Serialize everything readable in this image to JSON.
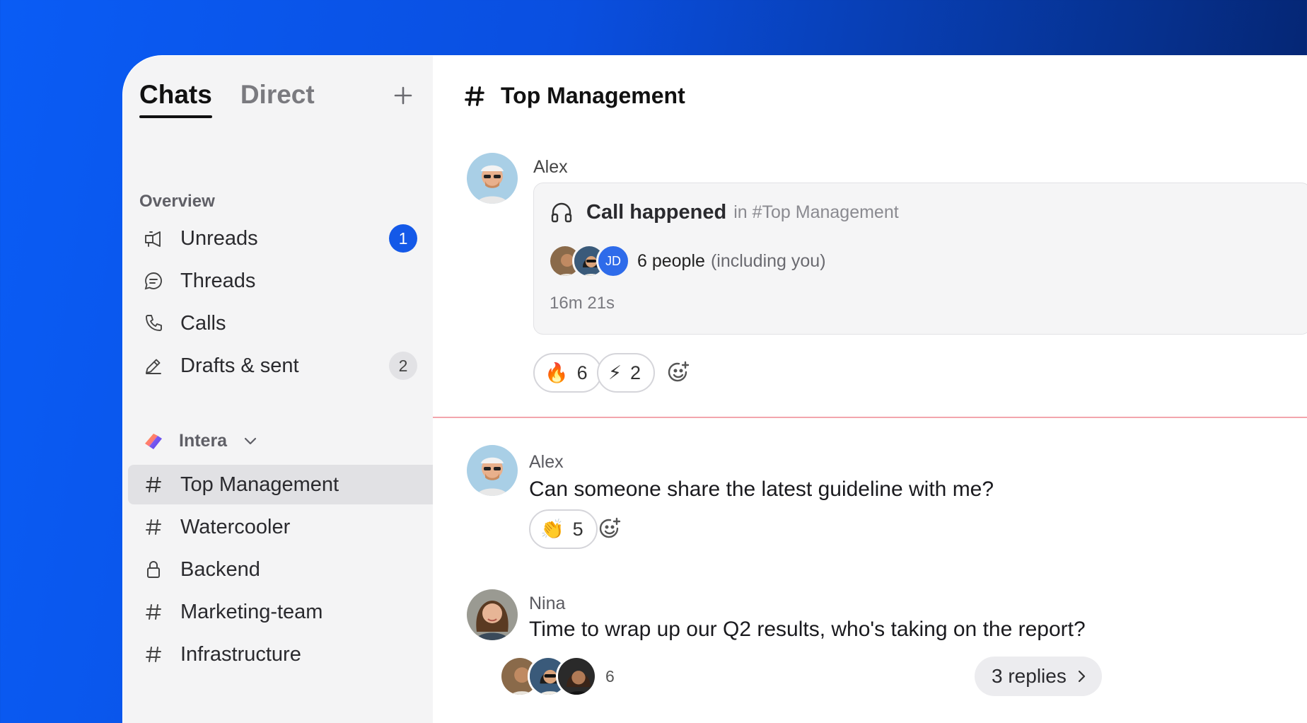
{
  "sidebar": {
    "tabs": [
      {
        "label": "Chats",
        "active": true
      },
      {
        "label": "Direct",
        "active": false
      }
    ],
    "add_icon": "plus-icon",
    "overview_title": "Overview",
    "overview_items": [
      {
        "label": "Unreads",
        "icon": "megaphone-icon",
        "badge": "1"
      },
      {
        "label": "Threads",
        "icon": "chat-bubble-icon",
        "badge": null
      },
      {
        "label": "Calls",
        "icon": "phone-icon",
        "badge": null
      },
      {
        "label": "Drafts & sent",
        "icon": "pencil-icon",
        "badge": "2"
      }
    ],
    "workspace": {
      "name": "Intera"
    },
    "channels": [
      {
        "label": "Top Management",
        "icon": "hash-icon",
        "selected": true
      },
      {
        "label": "Watercooler",
        "icon": "hash-icon",
        "selected": false
      },
      {
        "label": "Backend",
        "icon": "lock-icon",
        "selected": false
      },
      {
        "label": "Marketing-team",
        "icon": "hash-icon",
        "selected": false
      },
      {
        "label": "Infrastructure",
        "icon": "hash-icon",
        "selected": false
      }
    ]
  },
  "channel": {
    "name": "Top Management"
  },
  "messages": [
    {
      "author": "Alex",
      "call": {
        "title": "Call happened",
        "location": "in #Top Management",
        "participants_initials": "JD",
        "people_count": "6 people",
        "people_note": "(including you)",
        "duration": "16m 21s"
      },
      "reactions": [
        {
          "emoji": "🔥",
          "count": "6"
        },
        {
          "emoji": "⚡",
          "count": "2"
        }
      ]
    },
    {
      "author": "Alex",
      "text": "Can someone share the latest guideline with me?",
      "reactions": [
        {
          "emoji": "👏",
          "count": "5"
        }
      ]
    },
    {
      "author": "Nina",
      "text": "Time to wrap up our Q2 results, who's taking on the report?",
      "thread_participants": "6",
      "replies": "3 replies"
    }
  ],
  "colors": {
    "accent": "#1459e8",
    "unread_divider": "#f3a6ad",
    "sidebar_bg": "#f4f4f5"
  }
}
